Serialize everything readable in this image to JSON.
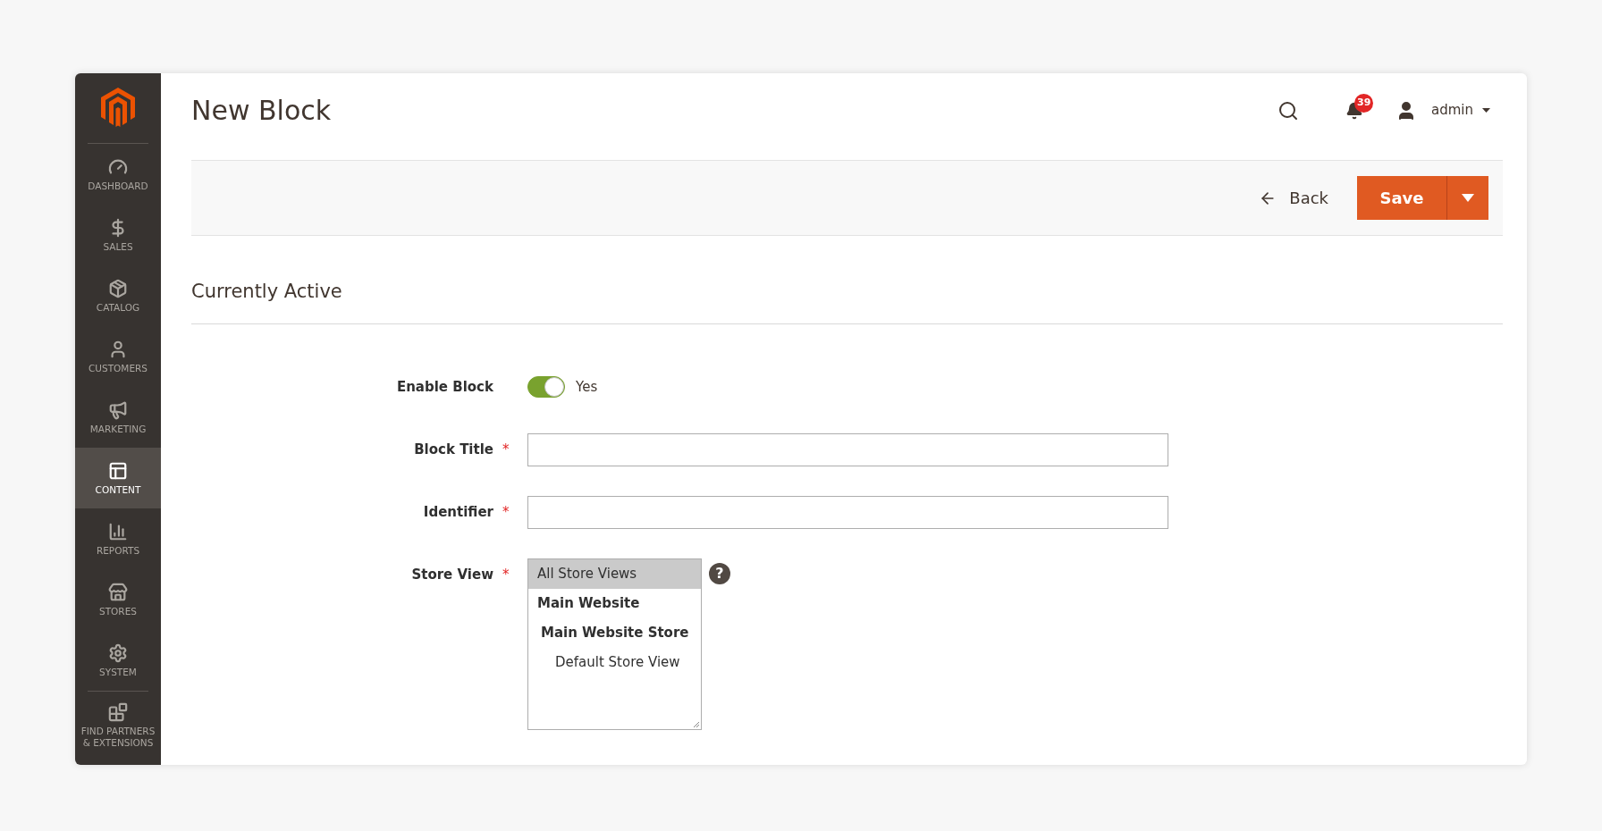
{
  "sidebar": {
    "items": [
      {
        "label": "DASHBOARD",
        "selected": false
      },
      {
        "label": "SALES",
        "selected": false
      },
      {
        "label": "CATALOG",
        "selected": false
      },
      {
        "label": "CUSTOMERS",
        "selected": false
      },
      {
        "label": "MARKETING",
        "selected": false
      },
      {
        "label": "CONTENT",
        "selected": true
      },
      {
        "label": "REPORTS",
        "selected": false
      },
      {
        "label": "STORES",
        "selected": false
      },
      {
        "label": "SYSTEM",
        "selected": false
      },
      {
        "label": "FIND PARTNERS & EXTENSIONS",
        "selected": false
      }
    ]
  },
  "header": {
    "title": "New Block",
    "notifications": "39",
    "user": "admin"
  },
  "actions": {
    "back": "Back",
    "save": "Save"
  },
  "section": {
    "title": "Currently Active"
  },
  "form": {
    "fields": [
      {
        "kind": "toggle",
        "label": "Enable Block",
        "on": true,
        "value": "Yes"
      },
      {
        "kind": "text",
        "label": "Block Title",
        "required_mark": "*"
      },
      {
        "kind": "text",
        "label": "Identifier",
        "required_mark": "*"
      },
      {
        "kind": "multiselect",
        "label": "Store View",
        "required_mark": "*",
        "help": "?",
        "options": [
          {
            "label": "All Store Views",
            "kind": "option",
            "selected": true
          },
          {
            "label": "Main Website",
            "kind": "group",
            "selected": false,
            "children": [
              {
                "label": "Main Website Store",
                "kind": "group",
                "selected": false,
                "children": [
                  {
                    "label": "Default Store View",
                    "kind": "option",
                    "selected": false
                  }
                ]
              }
            ]
          }
        ]
      }
    ]
  }
}
